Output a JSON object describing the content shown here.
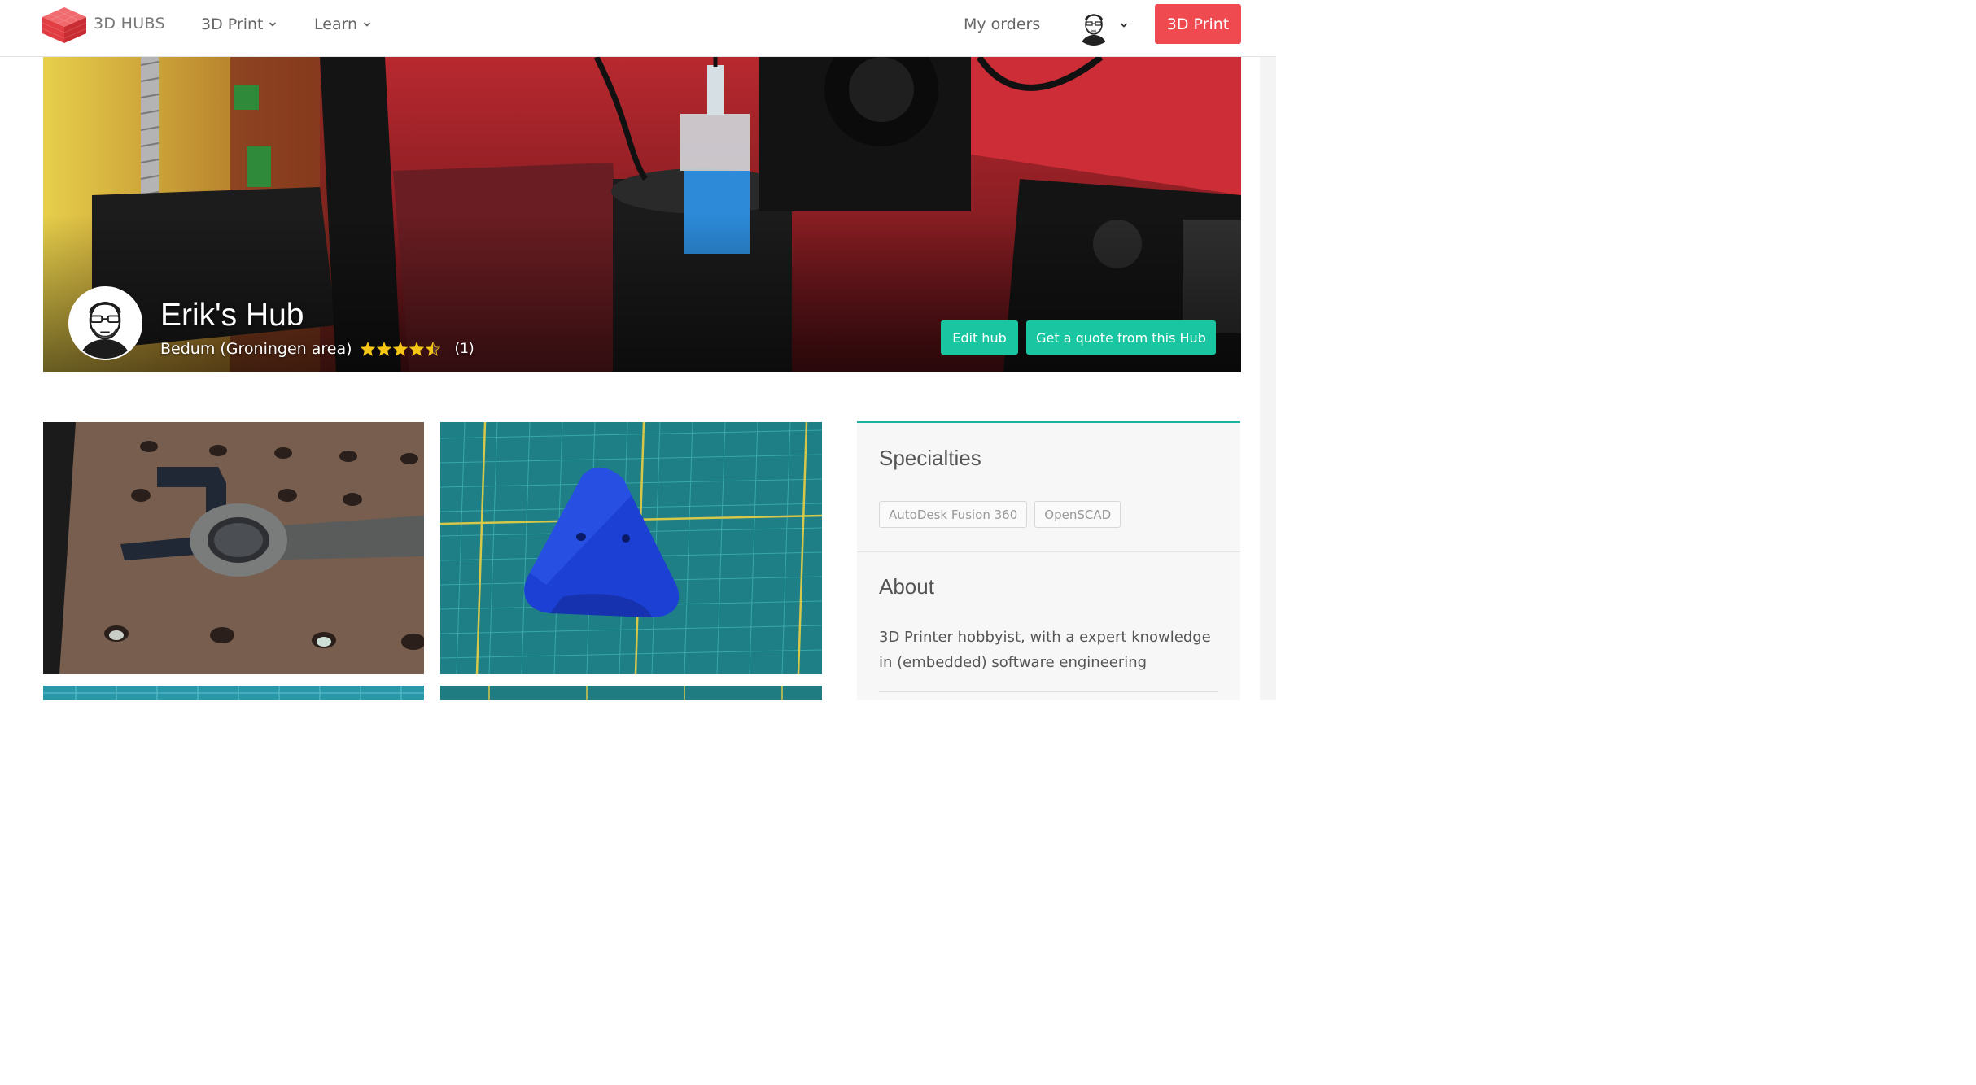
{
  "nav": {
    "brand": "3D HUBS",
    "items": [
      {
        "label": "3D Print",
        "icon": "chevron-down-icon"
      },
      {
        "label": "Learn",
        "icon": "chevron-down-icon"
      }
    ],
    "my_orders": "My orders",
    "cta": "3D Print",
    "colors": {
      "cta": "#ef4a4f",
      "logo": "#e54b50"
    }
  },
  "hub": {
    "name": "Erik's Hub",
    "location": "Bedum (Groningen area)",
    "rating": 4.5,
    "rating_max": 5,
    "review_count": "(1)",
    "edit_label": "Edit hub",
    "quote_label": "Get a quote from this Hub",
    "colors": {
      "buttons": "#1ac6a2"
    }
  },
  "gallery": {
    "photos": [
      {
        "subject": "3D printed wrench holder on pegboard"
      },
      {
        "subject": "blue 3D printed triangle part on cutting mat"
      },
      {
        "subject": "print on cutting mat"
      },
      {
        "subject": "print on cutting mat"
      }
    ]
  },
  "sidebar": {
    "specialties_title": "Specialties",
    "specialties": [
      "AutoDesk Fusion 360",
      "OpenSCAD"
    ],
    "about_title": "About",
    "about_text": "3D Printer hobbyist, with a expert knowledge in (embedded) software engineering",
    "colors": {
      "accent": "#1ab39b"
    }
  }
}
